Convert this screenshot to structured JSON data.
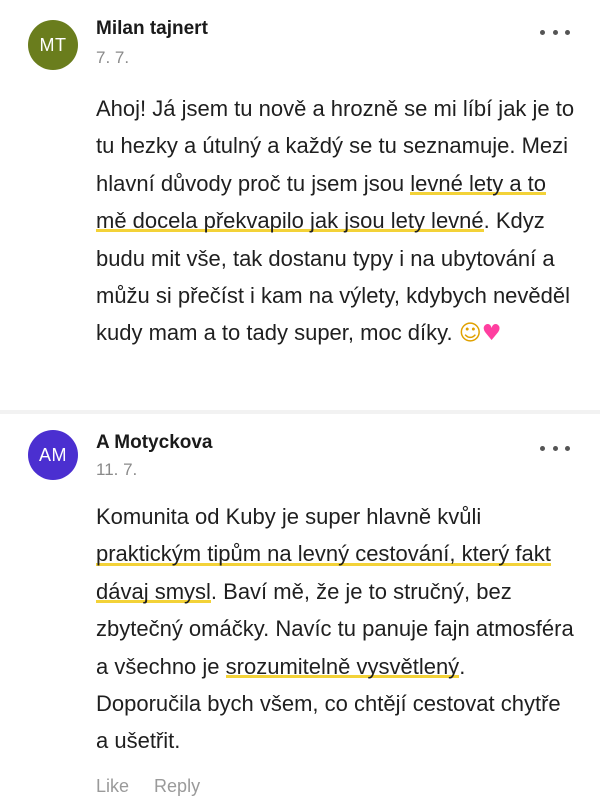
{
  "comments": [
    {
      "initials": "MT",
      "avatar_color": "#6a7d1d",
      "author": "Milan tajnert",
      "date": "7. 7.",
      "text_before": "Ahoj! Já jsem tu nově a hrozně se mi líbí jak je to tu hezky a útulný a každý se tu seznamuje. Mezi hlavní důvody proč tu jsem jsou ",
      "highlight_1": "levné lety a to mě docela překvapilo jak jsou lety levné",
      "text_after": ". Kdyz budu mit vše, tak dostanu typy i na ubytování a můžu si přečíst i kam na výlety, kdybych nevěděl kudy mam a  to tady super, moc díky. ",
      "emoji_1": "☺",
      "emoji_2": "♥"
    },
    {
      "initials": "AM",
      "avatar_color": "#4b2fd0",
      "author": "A Motyckova",
      "date": "11. 7.",
      "text_before": "Komunita od Kuby je super hlavně kvůli ",
      "highlight_1": "praktickým tipům na levný cestování, který fakt dávaj smysl",
      "text_middle": ". Baví mě, že je to stručný, bez zbytečný omáčky. Navíc tu panuje fajn atmosféra a všechno je ",
      "highlight_2": "srozumitelně vysvětlený",
      "text_after": ". Doporučila bych všem, co chtějí cestovat chytře a ušetřit."
    }
  ],
  "actions": {
    "like_label": "Like",
    "reply_label": "Reply"
  },
  "colors": {
    "highlight_underline": "#f3d238",
    "meta_text": "#8a8a8a"
  }
}
